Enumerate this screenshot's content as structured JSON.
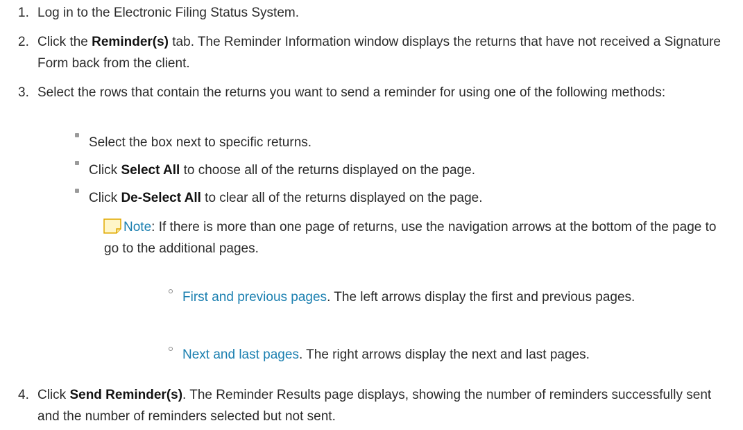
{
  "steps": {
    "s1": {
      "num": "1.",
      "text": "Log in to the Electronic Filing Status System."
    },
    "s2": {
      "num": "2.",
      "pre": "Click the ",
      "bold": "Reminder(s)",
      "post": " tab. The Reminder Information window displays the returns that have not received a Signature Form back from the client."
    },
    "s3": {
      "num": "3.",
      "text": "Select the rows that contain the returns you want to send a reminder for using one of the following methods:"
    },
    "s4": {
      "num": "4.",
      "pre": "Click ",
      "bold": "Send Reminder(s)",
      "post": ". The Reminder Results page displays, showing the number of reminders successfully sent and the number of reminders selected but not sent."
    }
  },
  "bullets": {
    "b1": {
      "text": "Select the box next to specific returns."
    },
    "b2": {
      "pre": "Click ",
      "bold": "Select All",
      "post": " to choose all of the returns displayed on the page."
    },
    "b3": {
      "pre": "Click ",
      "bold": "De-Select All",
      "post": " to clear all of the returns displayed on the page."
    }
  },
  "note": {
    "label": "Note",
    "text": ": If there is more than one page of returns, use the navigation arrows at the bottom of the page to go to the additional pages."
  },
  "subitems": {
    "first": {
      "link": "First and previous pages",
      "text": ". The left arrows display the first and previous pages."
    },
    "next": {
      "link": "Next and last pages",
      "text": ". The right arrows display the next and last pages."
    }
  },
  "colors": {
    "link": "#1a7fb0",
    "text": "#2b2b2b",
    "note_icon_fill": "#fff6c8",
    "note_icon_stroke": "#e0a800"
  },
  "icons": {
    "note": "note-icon"
  }
}
